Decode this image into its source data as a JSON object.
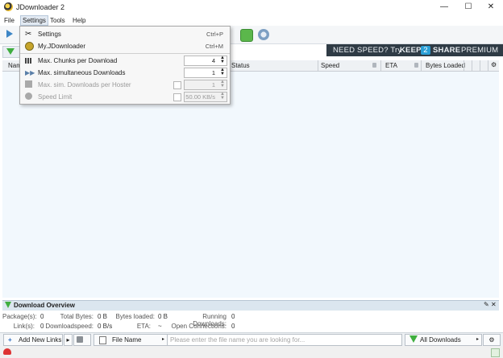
{
  "window": {
    "title": "JDownloader 2",
    "min": "—",
    "max": "☐",
    "close": "✕"
  },
  "menubar": {
    "file": "File",
    "settings": "Settings",
    "tools": "Tools",
    "help": "Help"
  },
  "dropdown": {
    "settings": {
      "label": "Settings",
      "shortcut": "Ctrl+P"
    },
    "myjd": {
      "label": "My.JDownloader",
      "shortcut": "Ctrl+M"
    },
    "chunks": {
      "label": "Max. Chunks per Download",
      "value": "4"
    },
    "simultaneous": {
      "label": "Max. simultaneous Downloads",
      "value": "1"
    },
    "perhoster": {
      "label": "Max. sim. Downloads per Hoster",
      "value": "1"
    },
    "speedlimit": {
      "label": "Speed Limit",
      "value": "50.00 KB/s"
    }
  },
  "banner": {
    "part1": "NEED SPEED? Try",
    "brand1": "KEEP",
    "num": "2",
    "brand2": "SHARE",
    "tier": "PREMIUM"
  },
  "table": {
    "columns": {
      "name": "Nam",
      "status": "Status",
      "speed": "Speed",
      "eta": "ETA",
      "bytes_loaded": "Bytes Loaded"
    }
  },
  "overview": {
    "title": "Download Overview",
    "packages_label": "Package(s):",
    "packages": "0",
    "links_label": "Link(s):",
    "links": "0",
    "total_bytes_label": "Total Bytes:",
    "total_bytes": "0 B",
    "speed_label": "Downloadspeed:",
    "speed": "0 B/s",
    "bytes_loaded_label": "Bytes loaded:",
    "bytes_loaded": "0 B",
    "eta_label": "ETA:",
    "eta": "~",
    "running_label": "Running Downloads:",
    "running": "0",
    "connections_label": "Open Connections:",
    "connections": "0"
  },
  "bottombar": {
    "add_links": "Add New Links",
    "filter_column": "File Name",
    "search_placeholder": "Please enter the file name you are looking for...",
    "view_select": "All Downloads"
  },
  "colors": {
    "accent": "#2f3b45",
    "table_bg": "#f2f8fd",
    "overview_header": "#dbe6ef",
    "green": "#3fae3f"
  }
}
